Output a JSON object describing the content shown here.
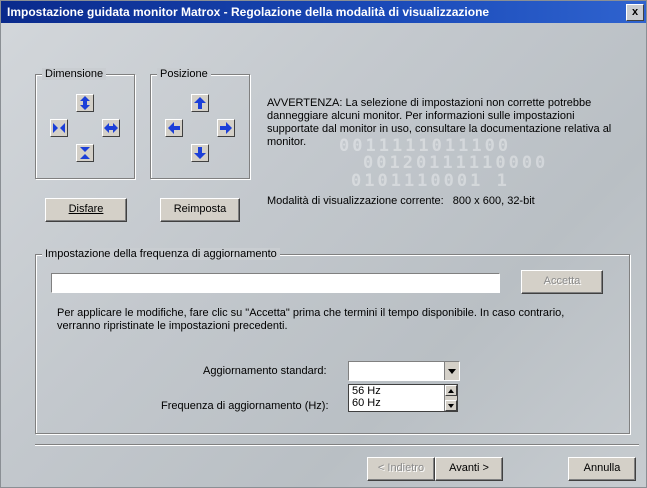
{
  "window": {
    "title": "Impostazione guidata monitor Matrox - Regolazione della modalità di visualizzazione",
    "close_label": "x"
  },
  "decor": {
    "line1": "0011111011100",
    "line2": "00120111110000",
    "line3": "0101110001 1"
  },
  "dimensione": {
    "legend": "Dimensione",
    "undo_label": "Disfare"
  },
  "posizione": {
    "legend": "Posizione",
    "reset_label": "Reimposta"
  },
  "warning": "AVVERTENZA: La selezione di impostazioni non corrette potrebbe danneggiare alcuni monitor. Per informazioni sulle impostazioni supportate dal monitor in uso, consultare la documentazione relativa al monitor.",
  "current_mode": {
    "label": "Modalità di visualizzazione corrente:",
    "value": "800 x 600, 32-bit"
  },
  "refresh": {
    "legend": "Impostazione della frequenza di aggiornamento",
    "accept_label": "Accetta",
    "instructions": "Per applicare le modifiche, fare clic su \"Accetta\" prima che termini il tempo disponibile. In caso contrario, verranno ripristinate le impostazioni precedenti.",
    "standard_label": "Aggiornamento standard:",
    "standard_value": "",
    "frequency_label": "Frequenza di aggiornamento (Hz):",
    "options": [
      "56 Hz",
      "60 Hz"
    ],
    "countdown_fraction": 0
  },
  "nav": {
    "back_label": "< Indietro",
    "next_label": "Avanti >",
    "cancel_label": "Annulla"
  },
  "colors": {
    "title_bar": "#0a2a8c",
    "arrow_blue": "#1c3fd8"
  }
}
